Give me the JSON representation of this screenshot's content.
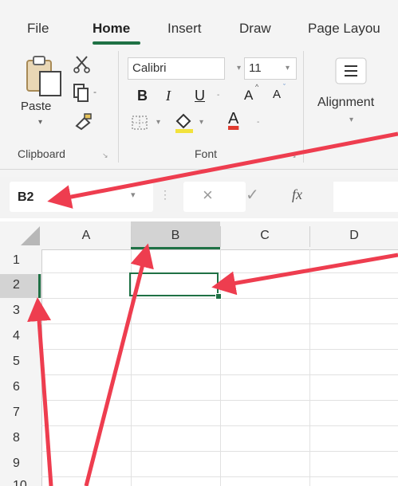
{
  "menu": {
    "tabs": [
      "File",
      "Home",
      "Insert",
      "Draw",
      "Page Layou"
    ]
  },
  "ribbon": {
    "clipboard": {
      "paste_label": "Paste",
      "group_label": "Clipboard"
    },
    "font": {
      "font_name": "Calibri",
      "font_size": "11",
      "bold": "B",
      "italic": "I",
      "underline": "U",
      "grow": "A",
      "shrink": "A",
      "font_color_glyph": "A",
      "group_label": "Font"
    },
    "alignment": {
      "label": "Alignment"
    }
  },
  "formula_bar": {
    "name_box": "B2",
    "cancel_glyph": "×",
    "enter_glyph": "✓",
    "fx_glyph": "fx"
  },
  "sheet": {
    "columns": [
      "A",
      "B",
      "C",
      "D"
    ],
    "rows": [
      "1",
      "2",
      "3",
      "4",
      "5",
      "6",
      "7",
      "8",
      "9",
      "10"
    ],
    "selected_cell": "B2"
  },
  "colors": {
    "accent_green": "#1f7145",
    "arrow_red": "#ee3d4f"
  },
  "icons": [
    "paste-icon",
    "cut-icon",
    "copy-icon",
    "format-painter-icon",
    "borders-icon",
    "fill-color-icon",
    "alignment-icon",
    "dropdown-icon"
  ]
}
